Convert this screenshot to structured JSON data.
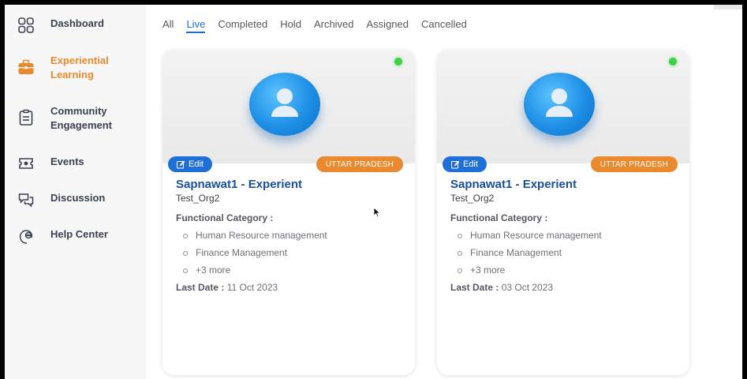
{
  "sidebar": {
    "items": [
      {
        "label": "Dashboard",
        "icon": "dashboard-grid-icon",
        "active": false
      },
      {
        "label": "Experiential Learning",
        "icon": "briefcase-icon",
        "active": true
      },
      {
        "label": "Community Engagement",
        "icon": "clipboard-icon",
        "active": false
      },
      {
        "label": "Events",
        "icon": "ticket-icon",
        "active": false
      },
      {
        "label": "Discussion",
        "icon": "chat-bubbles-icon",
        "active": false
      },
      {
        "label": "Help Center",
        "icon": "headset-icon",
        "active": false
      }
    ]
  },
  "tabs": [
    "All",
    "Live",
    "Completed",
    "Hold",
    "Archived",
    "Assigned",
    "Cancelled"
  ],
  "active_tab": "Live",
  "colors": {
    "accent": "#e8892b",
    "primary": "#1f6fd6",
    "title": "#1a4f99",
    "badge": "#ea8a2f",
    "status_live": "#3fd145"
  },
  "cards": [
    {
      "edit_label": "Edit",
      "region": "UTTAR PRADESH",
      "title": "Sapnawat1 - Experient",
      "org": "Test_Org2",
      "category_label": "Functional Category :",
      "categories": [
        "Human Resource management",
        "Finance Management",
        "+3 more"
      ],
      "last_date_label": "Last Date :",
      "last_date": "11 Oct 2023"
    },
    {
      "edit_label": "Edit",
      "region": "UTTAR PRADESH",
      "title": "Sapnawat1 - Experient",
      "org": "Test_Org2",
      "category_label": "Functional Category :",
      "categories": [
        "Human Resource management",
        "Finance Management",
        "+3 more"
      ],
      "last_date_label": "Last Date :",
      "last_date": "03 Oct 2023"
    }
  ]
}
